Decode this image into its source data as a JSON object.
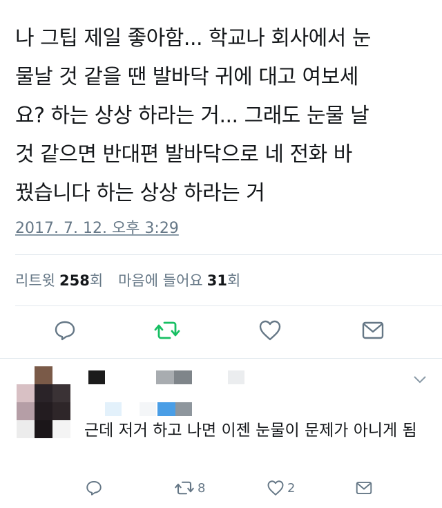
{
  "tweet": {
    "lines": [
      "나 그팁 제일 좋아함... 학교나 회사에서 눈",
      "물날 것 같을 땐 발바닥 귀에 대고 여보세",
      "요? 하는 상상 하라는 거... 그래도 눈물 날",
      "것 같으면 반대편 발바닥으로 네 전화 바",
      "꿨습니다 하는 상상 하라는 거"
    ],
    "date": "2017. 7. 12. 오후 3:29",
    "stats": {
      "retweet_label": "리트윗",
      "retweet_count": "258",
      "retweet_unit": "회",
      "like_label": "마음에 들어요",
      "like_count": "31",
      "like_unit": "회"
    },
    "actions": {
      "reply_icon": "reply-icon",
      "retweet_icon": "retweet-icon",
      "like_icon": "heart-icon",
      "message_icon": "message-icon",
      "retweet_color": "#17bf63"
    }
  },
  "reply": {
    "text": "근데 저거 하고 나면 이젠 눈물이 문제가 아니게 됨",
    "retweet_count": "8",
    "like_count": "2"
  },
  "colors": {
    "text": "#14171a",
    "secondary": "#657786",
    "divider": "#e1e8ed",
    "accent_green": "#17bf63"
  }
}
